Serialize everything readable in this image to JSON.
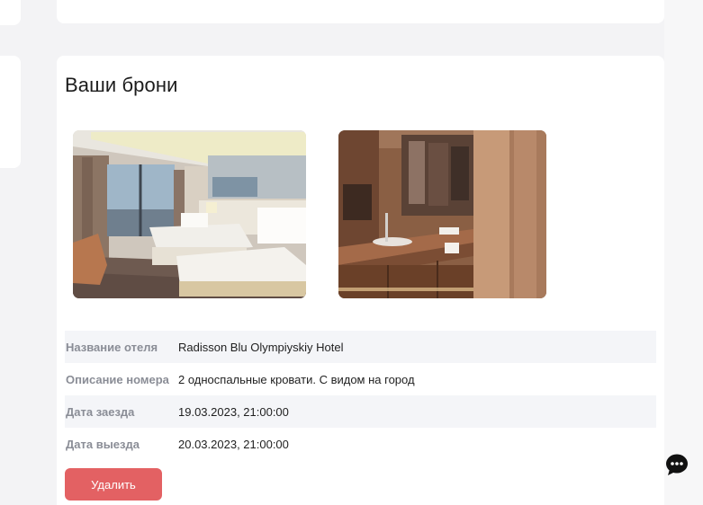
{
  "section": {
    "title": "Ваши брони"
  },
  "photos": [
    {
      "alt": "Номер с двумя кроватями"
    },
    {
      "alt": "Ванная комната"
    }
  ],
  "booking": {
    "rows": [
      {
        "label": "Название отеля",
        "value": "Radisson Blu Olympiyskiy Hotel"
      },
      {
        "label": "Описание номера",
        "value": "2 односпальные кровати. С видом на город"
      },
      {
        "label": "Дата заезда",
        "value": "19.03.2023, 21:00:00"
      },
      {
        "label": "Дата выезда",
        "value": "20.03.2023, 21:00:00"
      }
    ]
  },
  "actions": {
    "delete_label": "Удалить"
  },
  "icons": {
    "chat": "chat-bubble-icon"
  },
  "colors": {
    "accent_danger": "#e36163",
    "row_shade": "#f4f5f8",
    "label_text": "#8a8d96"
  }
}
